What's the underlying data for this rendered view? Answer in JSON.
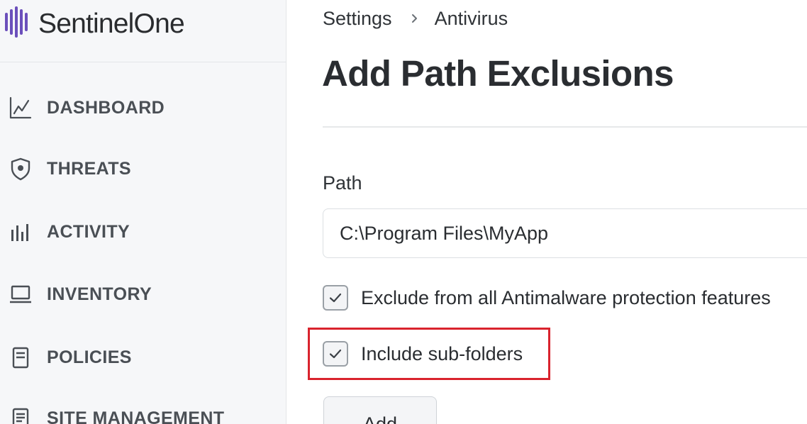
{
  "brand": {
    "name": "SentinelOne",
    "logo_color": "#6b4fbb"
  },
  "sidebar": {
    "items": [
      {
        "label": "DASHBOARD",
        "icon": "line-chart-icon"
      },
      {
        "label": "THREATS",
        "icon": "shield-icon"
      },
      {
        "label": "ACTIVITY",
        "icon": "bar-chart-icon"
      },
      {
        "label": "INVENTORY",
        "icon": "laptop-icon"
      },
      {
        "label": "POLICIES",
        "icon": "document-icon"
      },
      {
        "label": "SITE MANAGEMENT",
        "icon": "list-icon"
      }
    ]
  },
  "breadcrumb": {
    "parent": "Settings",
    "current": "Antivirus"
  },
  "page": {
    "title": "Add Path Exclusions"
  },
  "form": {
    "path_label": "Path",
    "path_value": "C:\\Program Files\\MyApp",
    "checkbox_antimalware": {
      "label": "Exclude from all Antimalware protection features",
      "checked": true
    },
    "checkbox_subfolders": {
      "label": "Include sub-folders",
      "checked": true
    },
    "add_label": "Add"
  },
  "colors": {
    "highlight": "#d9232d",
    "sidebar_bg": "#f6f7f9",
    "text": "#2f3337"
  }
}
